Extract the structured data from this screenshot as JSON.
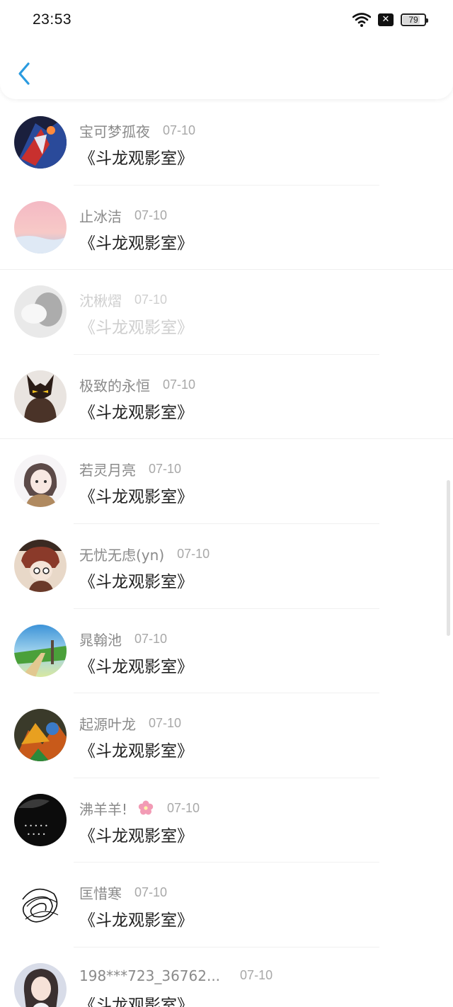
{
  "status_bar": {
    "time": "23:53",
    "battery": "79"
  },
  "list": {
    "items": [
      {
        "name": "宝可梦孤夜",
        "date": "07-10",
        "title": "《斗龙观影室》"
      },
      {
        "name": "止冰洁",
        "date": "07-10",
        "title": "《斗龙观影室》"
      },
      {
        "name": "沈楸熠",
        "date": "07-10",
        "title": "《斗龙观影室》"
      },
      {
        "name": "极致的永恒",
        "date": "07-10",
        "title": "《斗龙观影室》"
      },
      {
        "name": "若灵月亮",
        "date": "07-10",
        "title": "《斗龙观影室》"
      },
      {
        "name": "无忧无虑(yn)",
        "date": "07-10",
        "title": "《斗龙观影室》"
      },
      {
        "name": "晁翰池",
        "date": "07-10",
        "title": "《斗龙观影室》"
      },
      {
        "name": "起源叶龙",
        "date": "07-10",
        "title": "《斗龙观影室》"
      },
      {
        "name": "沸羊羊!",
        "date": "07-10",
        "title": "《斗龙观影室》"
      },
      {
        "name": "匡惜寒",
        "date": "07-10",
        "title": "《斗龙观影室》"
      },
      {
        "name": "198***723_36762...",
        "date": "07-10",
        "title": "《斗龙观影室》"
      }
    ]
  },
  "colors": {
    "accent": "#2a9be0"
  },
  "icons": {
    "back": "chevron-left-icon",
    "wifi": "wifi-icon",
    "sim": "no-sim-icon",
    "battery": "battery-icon",
    "flower": "cherry-blossom-icon"
  }
}
